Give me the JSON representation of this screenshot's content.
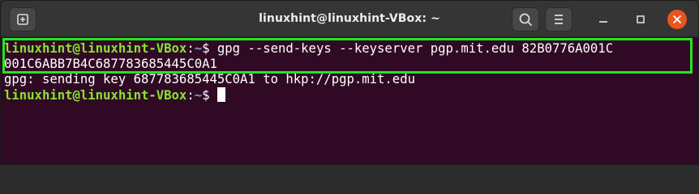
{
  "window": {
    "title": "linuxhint@linuxhint-VBox: ~"
  },
  "icons": {
    "new_tab": "new-tab-icon",
    "search": "search-icon",
    "menu": "hamburger-menu-icon",
    "minimize": "minimize-icon",
    "maximize": "maximize-icon",
    "close": "close-icon"
  },
  "colors": {
    "terminal_bg": "#300a24",
    "prompt_user": "#8ae234",
    "prompt_path": "#729fcf",
    "highlight_box": "#23e51f",
    "close_button": "#e95420"
  },
  "terminal": {
    "prompt_user": "linuxhint@linuxhint-VBox",
    "prompt_sep": ":",
    "prompt_path": "~",
    "prompt_symbol": "$ ",
    "lines": [
      {
        "command_line1": "gpg --send-keys --keyserver pgp.mit.edu 82B0776A001C",
        "command_line2": "001C6ABB7B4C687783685445C0A1"
      },
      {
        "output": "gpg: sending key 687783685445C0A1 to hkp://pgp.mit.edu"
      }
    ]
  }
}
